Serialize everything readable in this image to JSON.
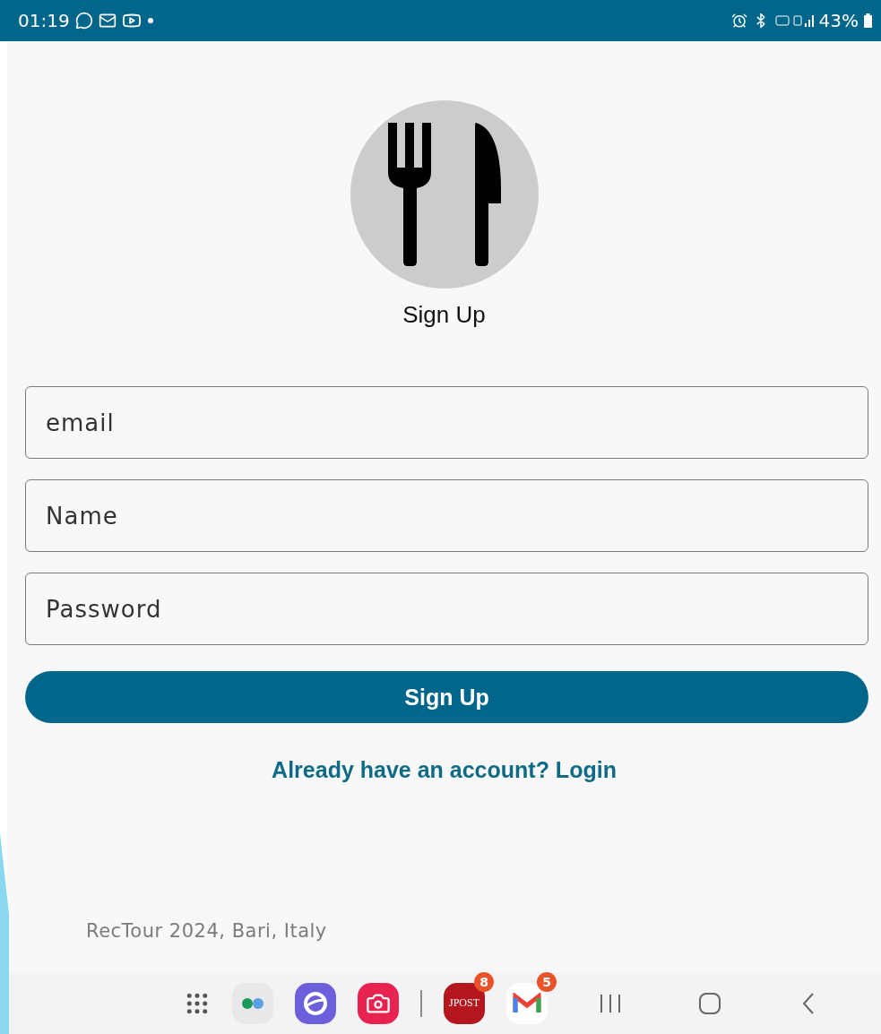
{
  "status_bar": {
    "time": "01:19",
    "battery": "43%"
  },
  "header": {
    "title": "Sign Up"
  },
  "fields": [
    {
      "placeholder": "email"
    },
    {
      "placeholder": "Name"
    },
    {
      "placeholder": "Password"
    }
  ],
  "submit_button": {
    "label": "Sign Up"
  },
  "login_link": "Already have an account? Login",
  "footer": "RecTour 2024, Bari, Italy",
  "dock": [
    {
      "kind": "apps"
    },
    {
      "kind": "folder"
    },
    {
      "kind": "browser"
    },
    {
      "kind": "camera"
    },
    {
      "kind": "divider"
    },
    {
      "kind": "news",
      "label": "JPOST",
      "badge": "8"
    },
    {
      "kind": "mail",
      "badge": "5"
    }
  ]
}
